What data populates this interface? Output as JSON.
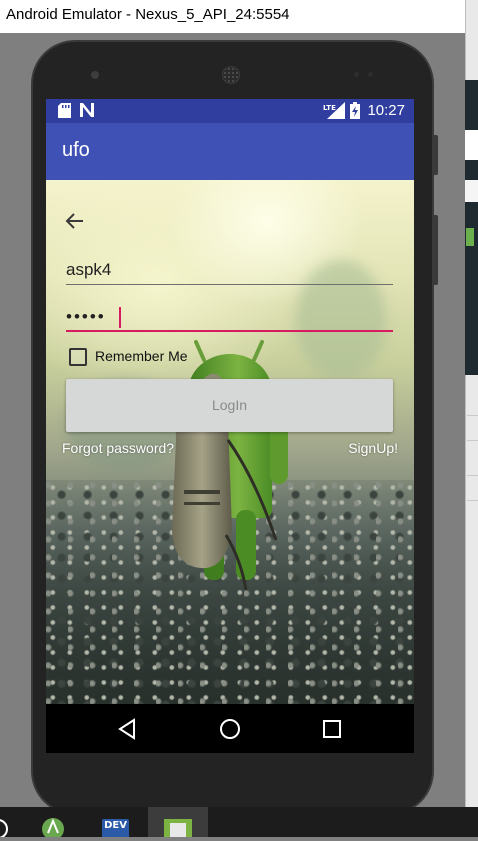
{
  "window": {
    "title": "Android Emulator - Nexus_5_API_24:5554"
  },
  "status_bar": {
    "time": "10:27",
    "network": "LTE"
  },
  "app_bar": {
    "title": "ufo"
  },
  "login_form": {
    "username_value": "aspk4",
    "password_value": "•••••",
    "remember_me_label": "Remember Me",
    "remember_me_checked": false,
    "login_button_label": "LogIn",
    "forgot_password_label": "Forgot password?",
    "signup_label": "SignUp!"
  },
  "nav_bar": {
    "buttons": [
      "back",
      "home",
      "recents"
    ]
  },
  "taskbar": {
    "items": [
      "android-studio",
      "dev-app",
      "emulator"
    ],
    "dev_label": "DEV"
  },
  "colors": {
    "primary": "#3f51b5",
    "primary_dark": "#303f9f",
    "accent": "#d81b60",
    "button_bg": "#d6d7d7"
  }
}
